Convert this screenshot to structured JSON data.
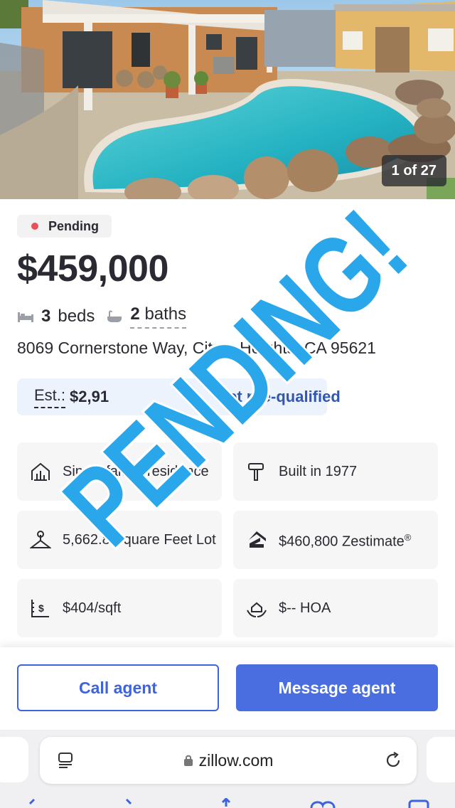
{
  "photo": {
    "counter": "1 of 27"
  },
  "listing": {
    "status": "Pending",
    "price": "$459,000",
    "beds_value": "3",
    "beds_label": "beds",
    "baths_value": "2",
    "baths_label": "baths",
    "address": "8069 Cornerstone Way, Citrus Heights, CA 95621",
    "est_label": "Est.:",
    "est_value": "$2,91",
    "prequal": "Get pre-qualified"
  },
  "features": [
    {
      "icon": "house-icon",
      "text": "Single family residence"
    },
    {
      "icon": "hammer-icon",
      "text": "Built in 1977"
    },
    {
      "icon": "lot-icon",
      "text": "5,662.8 Square Feet Lot"
    },
    {
      "icon": "zestimate-icon",
      "text": "$460,800 Zestimate",
      "sup": "®"
    },
    {
      "icon": "price-per-sqft-icon",
      "text": "$404/sqft"
    },
    {
      "icon": "hoa-icon",
      "text": "$-- HOA"
    }
  ],
  "actions": {
    "call": "Call agent",
    "message": "Message agent"
  },
  "browser": {
    "url": "zillow.com"
  },
  "overlay": {
    "text": "PENDING!",
    "color": "#2aa7ea"
  }
}
